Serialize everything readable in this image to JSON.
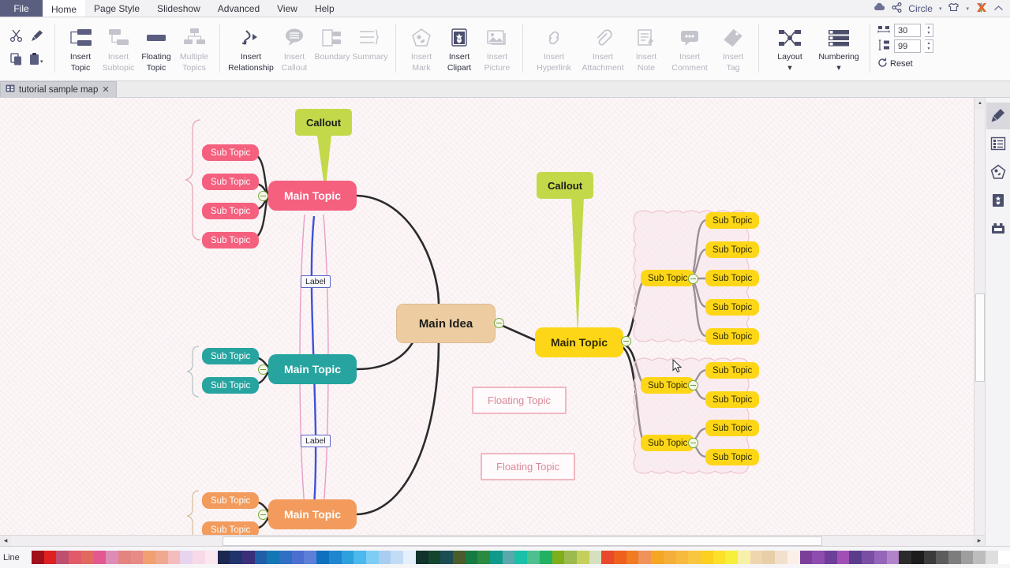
{
  "menu": {
    "file": "File",
    "items": [
      "Home",
      "Page Style",
      "Slideshow",
      "Advanced",
      "View",
      "Help"
    ],
    "active": "Home",
    "right": {
      "cloud_icon": "cloud-icon",
      "share_icon": "share-icon",
      "theme_label": "Circle",
      "theme_caret": "▾",
      "skin_icon": "skin-icon",
      "logo_icon": "app-logo-icon",
      "collapse_icon": "collapse-ribbon-icon"
    }
  },
  "ribbon": {
    "clipboard": [
      {
        "name": "cut-button",
        "icon": "scissors-icon"
      },
      {
        "name": "format-painter-button",
        "icon": "brush-icon"
      },
      {
        "name": "copy-button",
        "icon": "copy-icon"
      },
      {
        "name": "paste-button",
        "icon": "paste-icon"
      }
    ],
    "topic_group": [
      {
        "label_1": "Insert",
        "label_2": "Topic",
        "icon": "insert-topic-icon",
        "enabled": true,
        "dropdown": true
      },
      {
        "label_1": "Insert",
        "label_2": "Subtopic",
        "icon": "insert-subtopic-icon",
        "enabled": false,
        "dropdown": false
      },
      {
        "label_1": "Floating",
        "label_2": "Topic",
        "icon": "floating-topic-icon",
        "enabled": true,
        "dropdown": false
      },
      {
        "label_1": "Multiple",
        "label_2": "Topics",
        "icon": "multiple-topics-icon",
        "enabled": false,
        "dropdown": false
      }
    ],
    "relation_group": [
      {
        "label_1": "Insert",
        "label_2": "Relationship",
        "icon": "relationship-icon",
        "enabled": true
      },
      {
        "label_1": "Insert",
        "label_2": "Callout",
        "icon": "callout-icon",
        "enabled": false
      },
      {
        "label_1": "Boundary",
        "label_2": "",
        "icon": "boundary-icon",
        "enabled": false
      },
      {
        "label_1": "Summary",
        "label_2": "",
        "icon": "summary-icon",
        "enabled": false
      }
    ],
    "media_group": [
      {
        "label_1": "Insert",
        "label_2": "Mark",
        "icon": "insert-mark-icon",
        "enabled": false,
        "dropdown": true
      },
      {
        "label_1": "Insert",
        "label_2": "Clipart",
        "icon": "insert-clipart-icon",
        "enabled": true,
        "dropdown": false
      },
      {
        "label_1": "Insert",
        "label_2": "Picture",
        "icon": "insert-picture-icon",
        "enabled": false,
        "dropdown": false
      }
    ],
    "attach_group": [
      {
        "label_1": "Insert",
        "label_2": "Hyperlink",
        "icon": "hyperlink-icon",
        "enabled": false,
        "dropdown": false
      },
      {
        "label_1": "Insert",
        "label_2": "Attachment",
        "icon": "attachment-icon",
        "enabled": false,
        "dropdown": false
      },
      {
        "label_1": "Insert",
        "label_2": "Note",
        "icon": "note-icon",
        "enabled": false,
        "dropdown": false
      },
      {
        "label_1": "Insert",
        "label_2": "Comment",
        "icon": "comment-icon",
        "enabled": false,
        "dropdown": false
      },
      {
        "label_1": "Insert",
        "label_2": "Tag",
        "icon": "tag-icon",
        "enabled": false,
        "dropdown": true
      }
    ],
    "layout_group": [
      {
        "label_1": "Layout",
        "label_2": "",
        "icon": "layout-icon",
        "enabled": true,
        "dropdown": true
      },
      {
        "label_1": "Numbering",
        "label_2": "",
        "icon": "numbering-icon",
        "enabled": true,
        "dropdown": true
      }
    ],
    "spacing": {
      "horizontal_icon": "horizontal-spacing-icon",
      "horizontal_value": "30",
      "vertical_icon": "vertical-spacing-icon",
      "vertical_value": "99",
      "reset_icon": "reset-icon",
      "reset_label": "Reset"
    }
  },
  "doctab": {
    "icon": "map-document-icon",
    "title": "tutorial sample map",
    "close": "✕"
  },
  "map": {
    "center": {
      "label": "Main Idea",
      "color": "#eccca0"
    },
    "branches": [
      {
        "name": "pink-branch",
        "label": "Main Topic",
        "color": "#f4607e",
        "subtopics": [
          "Sub Topic",
          "Sub Topic",
          "Sub Topic",
          "Sub Topic"
        ],
        "callout": "Callout"
      },
      {
        "name": "teal-branch",
        "label": "Main Topic",
        "color": "#27a4a0",
        "subtopics": [
          "Sub Topic",
          "Sub Topic"
        ]
      },
      {
        "name": "orange-branch",
        "label": "Main Topic",
        "color": "#f29b5c",
        "subtopics": [
          "Sub Topic",
          "Sub Topic"
        ]
      },
      {
        "name": "yellow-branch",
        "label": "Main Topic",
        "color": "#fdd717",
        "callout": "Callout",
        "groups": [
          {
            "parent": "Sub Topic",
            "children": [
              "Sub Topic",
              "Sub Topic",
              "Sub Topic",
              "Sub Topic",
              "Sub Topic"
            ]
          },
          {
            "parent": "Sub Topic",
            "children": [
              "Sub Topic",
              "Sub Topic"
            ]
          },
          {
            "parent": "Sub Topic",
            "children": [
              "Sub Topic",
              "Sub Topic"
            ]
          }
        ]
      }
    ],
    "floating_topics": [
      "Floating Topic",
      "Floating Topic"
    ],
    "relationship_labels": [
      "Label",
      "Label"
    ],
    "callout_color": "#c3d94a",
    "relationship_color": "#3f51d8",
    "boundary_color": "#f0c4cc"
  },
  "rdock": [
    {
      "icon": "format-brush-icon",
      "name": "style-panel",
      "selected": true
    },
    {
      "icon": "outline-list-icon",
      "name": "outline-panel",
      "selected": false
    },
    {
      "icon": "clipart-panel-icon",
      "name": "clipart-panel",
      "selected": false
    },
    {
      "icon": "sticker-panel-icon",
      "name": "sticker-panel",
      "selected": false
    },
    {
      "icon": "library-panel-icon",
      "name": "library-panel",
      "selected": false
    }
  ],
  "status": {
    "line_label": "Line",
    "palette": [
      "#a00f1a",
      "#e02020",
      "#bf4f6e",
      "#e2596a",
      "#e2695f",
      "#e2588f",
      "#dd8cb6",
      "#e38480",
      "#e88a86",
      "#f0a071",
      "#efa98e",
      "#f4bcbc",
      "#e8d4ee",
      "#f7d9e8",
      "#fbe8ef",
      "#1c2850",
      "#20336b",
      "#3b2f7a",
      "#1f5fa8",
      "#1277b5",
      "#2f6fc4",
      "#4b6fd0",
      "#5d7fd8",
      "#1070c0",
      "#1e86cf",
      "#2ea0dd",
      "#4bb8ee",
      "#7dcdf5",
      "#a8cdf0",
      "#c3dcf5",
      "#e4f0fb",
      "#11332c",
      "#14452e",
      "#1b4d52",
      "#4b5b2a",
      "#167b42",
      "#2a8a3f",
      "#109a8a",
      "#5aa8aa",
      "#18c0a8",
      "#4cc08e",
      "#22b062",
      "#7fae1b",
      "#9cbb4e",
      "#c6cf5a",
      "#d6e0c0",
      "#e8492a",
      "#ef5f1e",
      "#f07b20",
      "#f0935b",
      "#f5a623",
      "#f6ae3a",
      "#f8b93f",
      "#f9c63f",
      "#fbd01f",
      "#fde02a",
      "#f8ef3c",
      "#f7f0a8",
      "#eed6b0",
      "#e8cfa8",
      "#f2e0cd",
      "#fbefe8",
      "#7b3f99",
      "#8e4bb0",
      "#6d3f9b",
      "#a14fb5",
      "#5b3c8a",
      "#7a4fa3",
      "#9465b8",
      "#b184c9",
      "#2b2b2b",
      "#1c1c1c",
      "#3b3b3b",
      "#5c5c5c",
      "#7d7d7d",
      "#9e9e9e",
      "#bdbdbd",
      "#dedede",
      "#ffffff"
    ]
  }
}
